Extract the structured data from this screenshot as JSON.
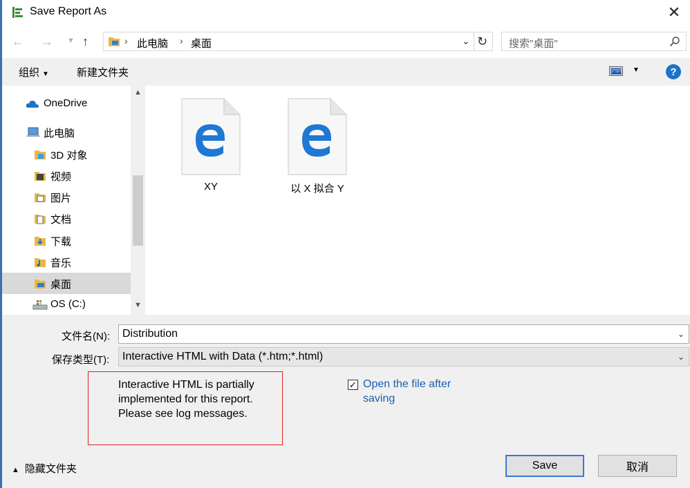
{
  "window": {
    "title": "Save Report As"
  },
  "address": {
    "crumbs": [
      "此电脑",
      "桌面"
    ],
    "search_placeholder": "搜索\"桌面\""
  },
  "toolbar": {
    "organize": "组织",
    "new_folder": "新建文件夹",
    "help": "?"
  },
  "nav": {
    "items": [
      {
        "label": "OneDrive",
        "icon": "onedrive-icon"
      },
      {
        "label": "此电脑",
        "icon": "computer-icon"
      },
      {
        "label": "3D 对象",
        "icon": "3d-objects-folder-icon"
      },
      {
        "label": "视频",
        "icon": "videos-folder-icon"
      },
      {
        "label": "图片",
        "icon": "pictures-folder-icon"
      },
      {
        "label": "文档",
        "icon": "documents-folder-icon"
      },
      {
        "label": "下载",
        "icon": "downloads-folder-icon"
      },
      {
        "label": "音乐",
        "icon": "music-folder-icon"
      },
      {
        "label": "桌面",
        "icon": "desktop-folder-icon",
        "selected": true
      },
      {
        "label": "OS (C:)",
        "icon": "drive-icon"
      }
    ]
  },
  "files": [
    {
      "name": "XY",
      "icon": "edge-html-file-icon"
    },
    {
      "name": "以 X 拟合 Y",
      "icon": "edge-html-file-icon"
    }
  ],
  "form": {
    "filename_label": "文件名(N):",
    "filename_value": "Distribution",
    "filetype_label": "保存类型(T):",
    "filetype_value": "Interactive HTML with Data (*.htm;*.html)"
  },
  "message": "Interactive HTML is partially implemented for this report. Please see log messages.",
  "open_after": {
    "label": "Open the file after saving",
    "checked": true,
    "mark": "✓"
  },
  "buttons": {
    "save": "Save",
    "cancel": "取消"
  },
  "hide_folders": "隐藏文件夹",
  "colors": {
    "accent": "#1e72c8",
    "link": "#1a5fb4",
    "message_border": "#e02020"
  }
}
